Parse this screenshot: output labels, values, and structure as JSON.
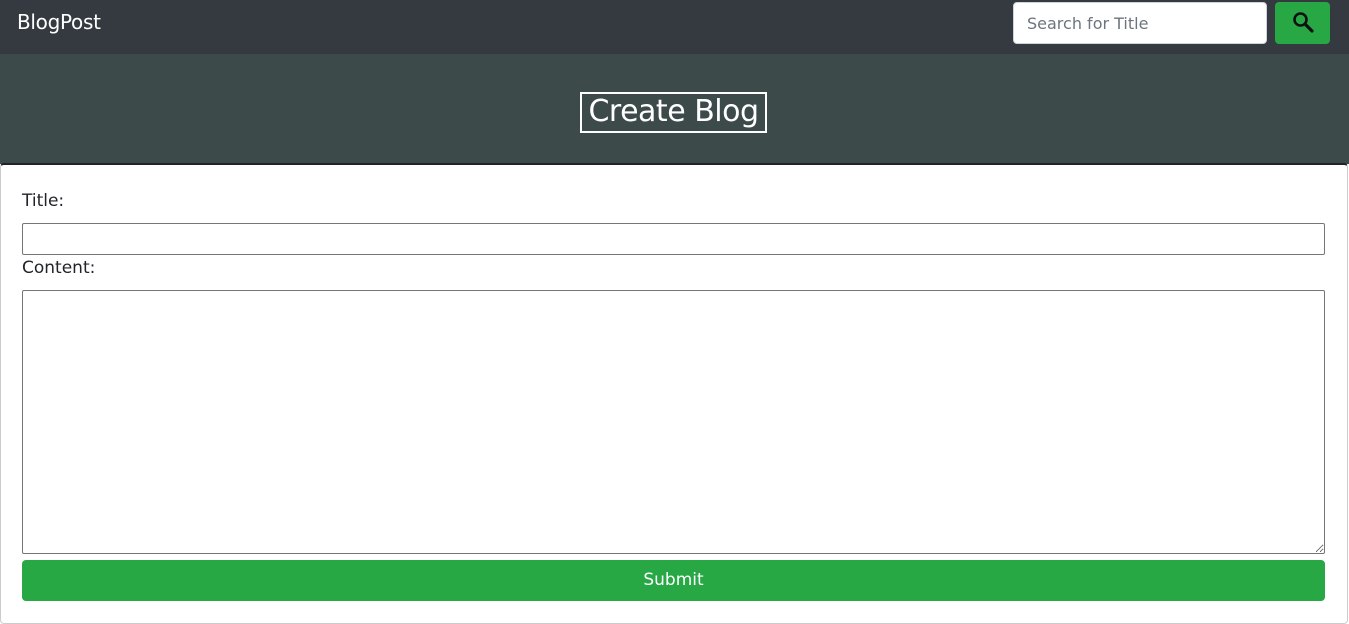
{
  "navbar": {
    "brand": "BlogPost",
    "search": {
      "placeholder": "Search for Title",
      "value": "",
      "button_icon": "search-icon"
    }
  },
  "hero": {
    "title": "Create Blog"
  },
  "form": {
    "title_label": "Title:",
    "title_value": "",
    "content_label": "Content:",
    "content_value": "",
    "submit_label": "Submit"
  },
  "colors": {
    "navbar_bg": "#343a40",
    "hero_bg": "#3d4a4a",
    "accent_green": "#28a745"
  }
}
